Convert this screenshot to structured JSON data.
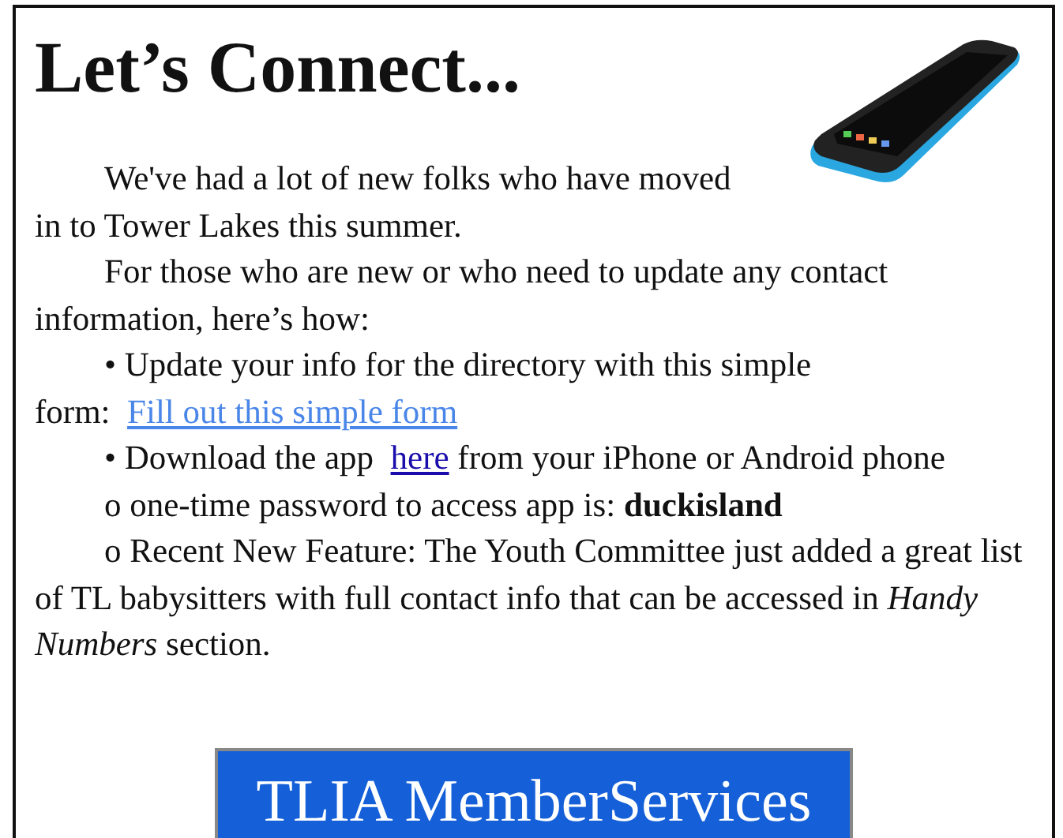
{
  "title": "Let’s Connect...",
  "intro": "We've had a lot of new folks who have moved in to Tower Lakes this summer.",
  "paragraphs": [
    {
      "kind": "text",
      "text": "For those who are new or who need to update any contact information, here’s how:"
    },
    {
      "kind": "link",
      "before": "• Update your info for the directory with this simple form:",
      "link": "Fill out this simple form",
      "color": "#4a86e8"
    },
    {
      "kind": "link",
      "before": "• Download the app",
      "link": "here",
      "after": "from your iPhone or Android phone",
      "color": "#1a0dab"
    },
    {
      "kind": "text",
      "text": "o  one-time password to access app is: **duckisland**"
    },
    {
      "kind": "text",
      "text": "o  Recent New Feature: The Youth Committee just added a great list of TL babysitters with full contact info that can be accessed in *Handy Numbers* section."
    }
  ],
  "banner": {
    "text": "TLIA MemberServices"
  }
}
